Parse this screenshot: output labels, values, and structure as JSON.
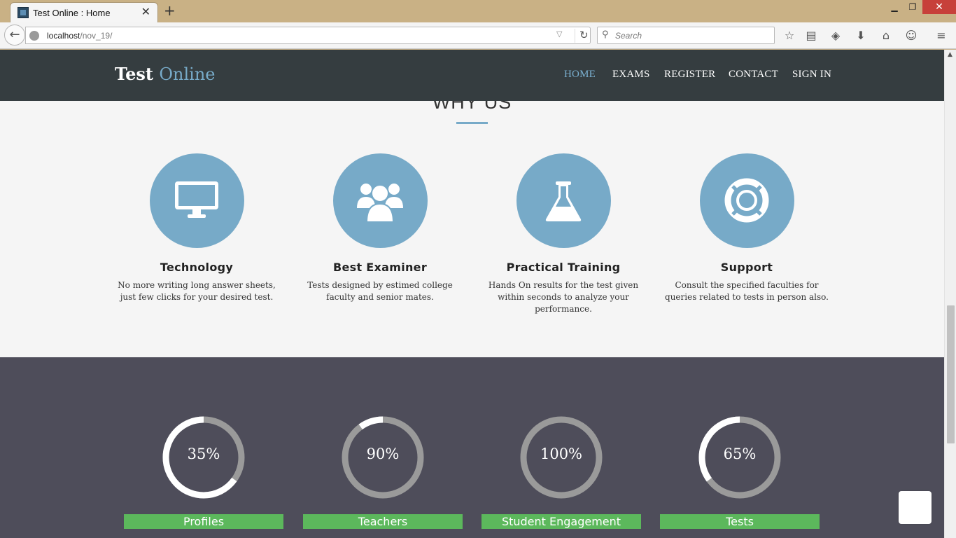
{
  "browser": {
    "tab_title": "Test Online : Home",
    "tab_close": "✕",
    "new_tab": "+",
    "window_min": "▁",
    "window_max": "❐",
    "window_close": "✕",
    "back": "←",
    "url_host": "localhost",
    "url_path": "/nov_19/",
    "url_dropdown": "▽",
    "reload": "↻",
    "search_placeholder": "Search",
    "search_glyph": "⚲",
    "toolbar_icons": [
      "star-icon",
      "reading-list-icon",
      "pocket-icon",
      "download-icon",
      "home-icon",
      "smiley-icon",
      "menu-icon"
    ],
    "toolbar_glyphs": [
      "☆",
      "▤",
      "◈",
      "⬇",
      "⌂",
      "☺",
      "≡"
    ]
  },
  "site": {
    "brand_main": "Test",
    "brand_accent": "Online",
    "nav": [
      "HOME",
      "EXAMS",
      "REGISTER",
      "CONTACT",
      "SIGN IN"
    ],
    "active_nav": "HOME",
    "accent_color": "#77aac8"
  },
  "why_us": {
    "title": "WHY US",
    "features": [
      {
        "icon": "monitor-icon",
        "title": "Technology",
        "desc": "No more writing long answer sheets, just few clicks for your desired test."
      },
      {
        "icon": "group-icon",
        "title": "Best Examiner",
        "desc": "Tests designed by estimed college faculty and senior mates."
      },
      {
        "icon": "flask-icon",
        "title": "Practical Training",
        "desc": "Hands On results for the test given within seconds to analyze your performance."
      },
      {
        "icon": "lifebuoy-icon",
        "title": "Support",
        "desc": "Consult the specified faculties for queries related to tests in person also."
      }
    ]
  },
  "stats": [
    {
      "value": "35%",
      "percent": 35,
      "label": "Profiles"
    },
    {
      "value": "90%",
      "percent": 90,
      "label": "Teachers"
    },
    {
      "value": "100%",
      "percent": 100,
      "label": "Student Engagement"
    },
    {
      "value": "65%",
      "percent": 65,
      "label": "Tests"
    }
  ],
  "colors": {
    "stat_bar": "#5cb85c",
    "stats_bg": "#4e4d5a",
    "nav_bg": "#353d40"
  }
}
